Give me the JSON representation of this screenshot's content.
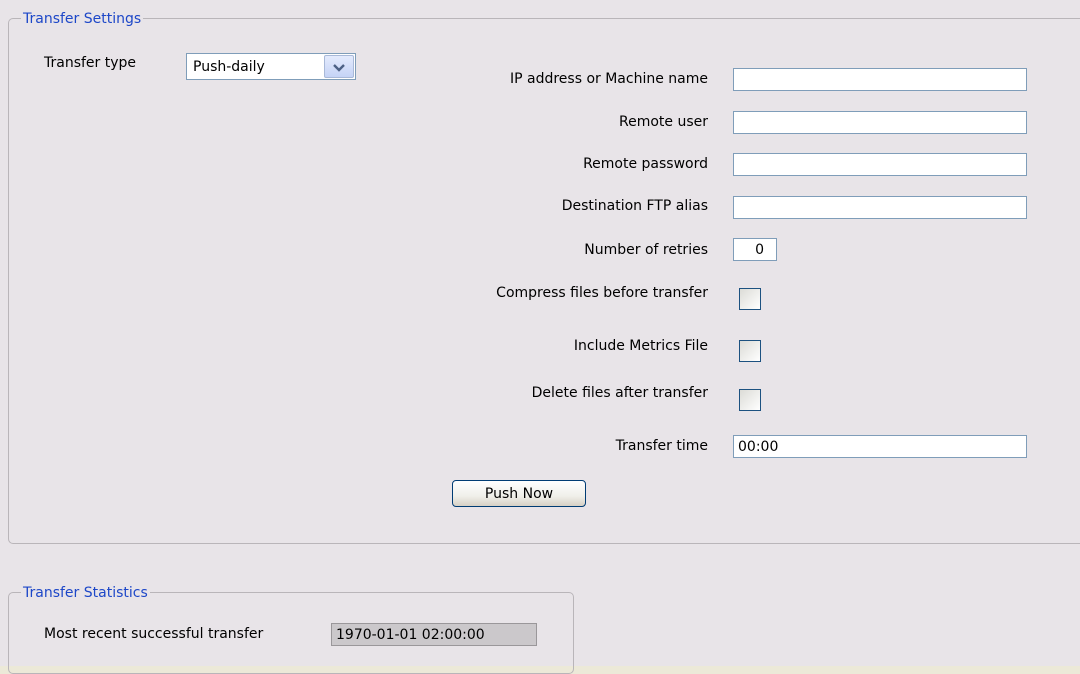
{
  "transfer_settings": {
    "legend": "Transfer Settings",
    "transfer_type": {
      "label": "Transfer type",
      "selected": "Push-daily"
    },
    "ip_address": {
      "label": "IP address or Machine name",
      "value": ""
    },
    "remote_user": {
      "label": "Remote user",
      "value": ""
    },
    "remote_password": {
      "label": "Remote password",
      "value": ""
    },
    "destination_ftp_alias": {
      "label": "Destination FTP alias",
      "value": ""
    },
    "number_of_retries": {
      "label": "Number of retries",
      "value": "0"
    },
    "compress_files": {
      "label": "Compress files before transfer",
      "checked": false
    },
    "include_metrics": {
      "label": "Include Metrics File",
      "checked": false
    },
    "delete_files": {
      "label": "Delete files after transfer",
      "checked": false
    },
    "transfer_time": {
      "label": "Transfer time",
      "value": "00:00"
    },
    "push_now_label": "Push Now"
  },
  "transfer_statistics": {
    "legend": "Transfer Statistics",
    "most_recent": {
      "label": "Most recent successful transfer",
      "value": "1970-01-01 02:00:00"
    }
  },
  "colors": {
    "background": "#e8e4e8",
    "legend_text": "#1d47c8",
    "readonly_field": "#cbc8cb"
  },
  "icons": {
    "dropdown": "chevron-down-icon"
  }
}
